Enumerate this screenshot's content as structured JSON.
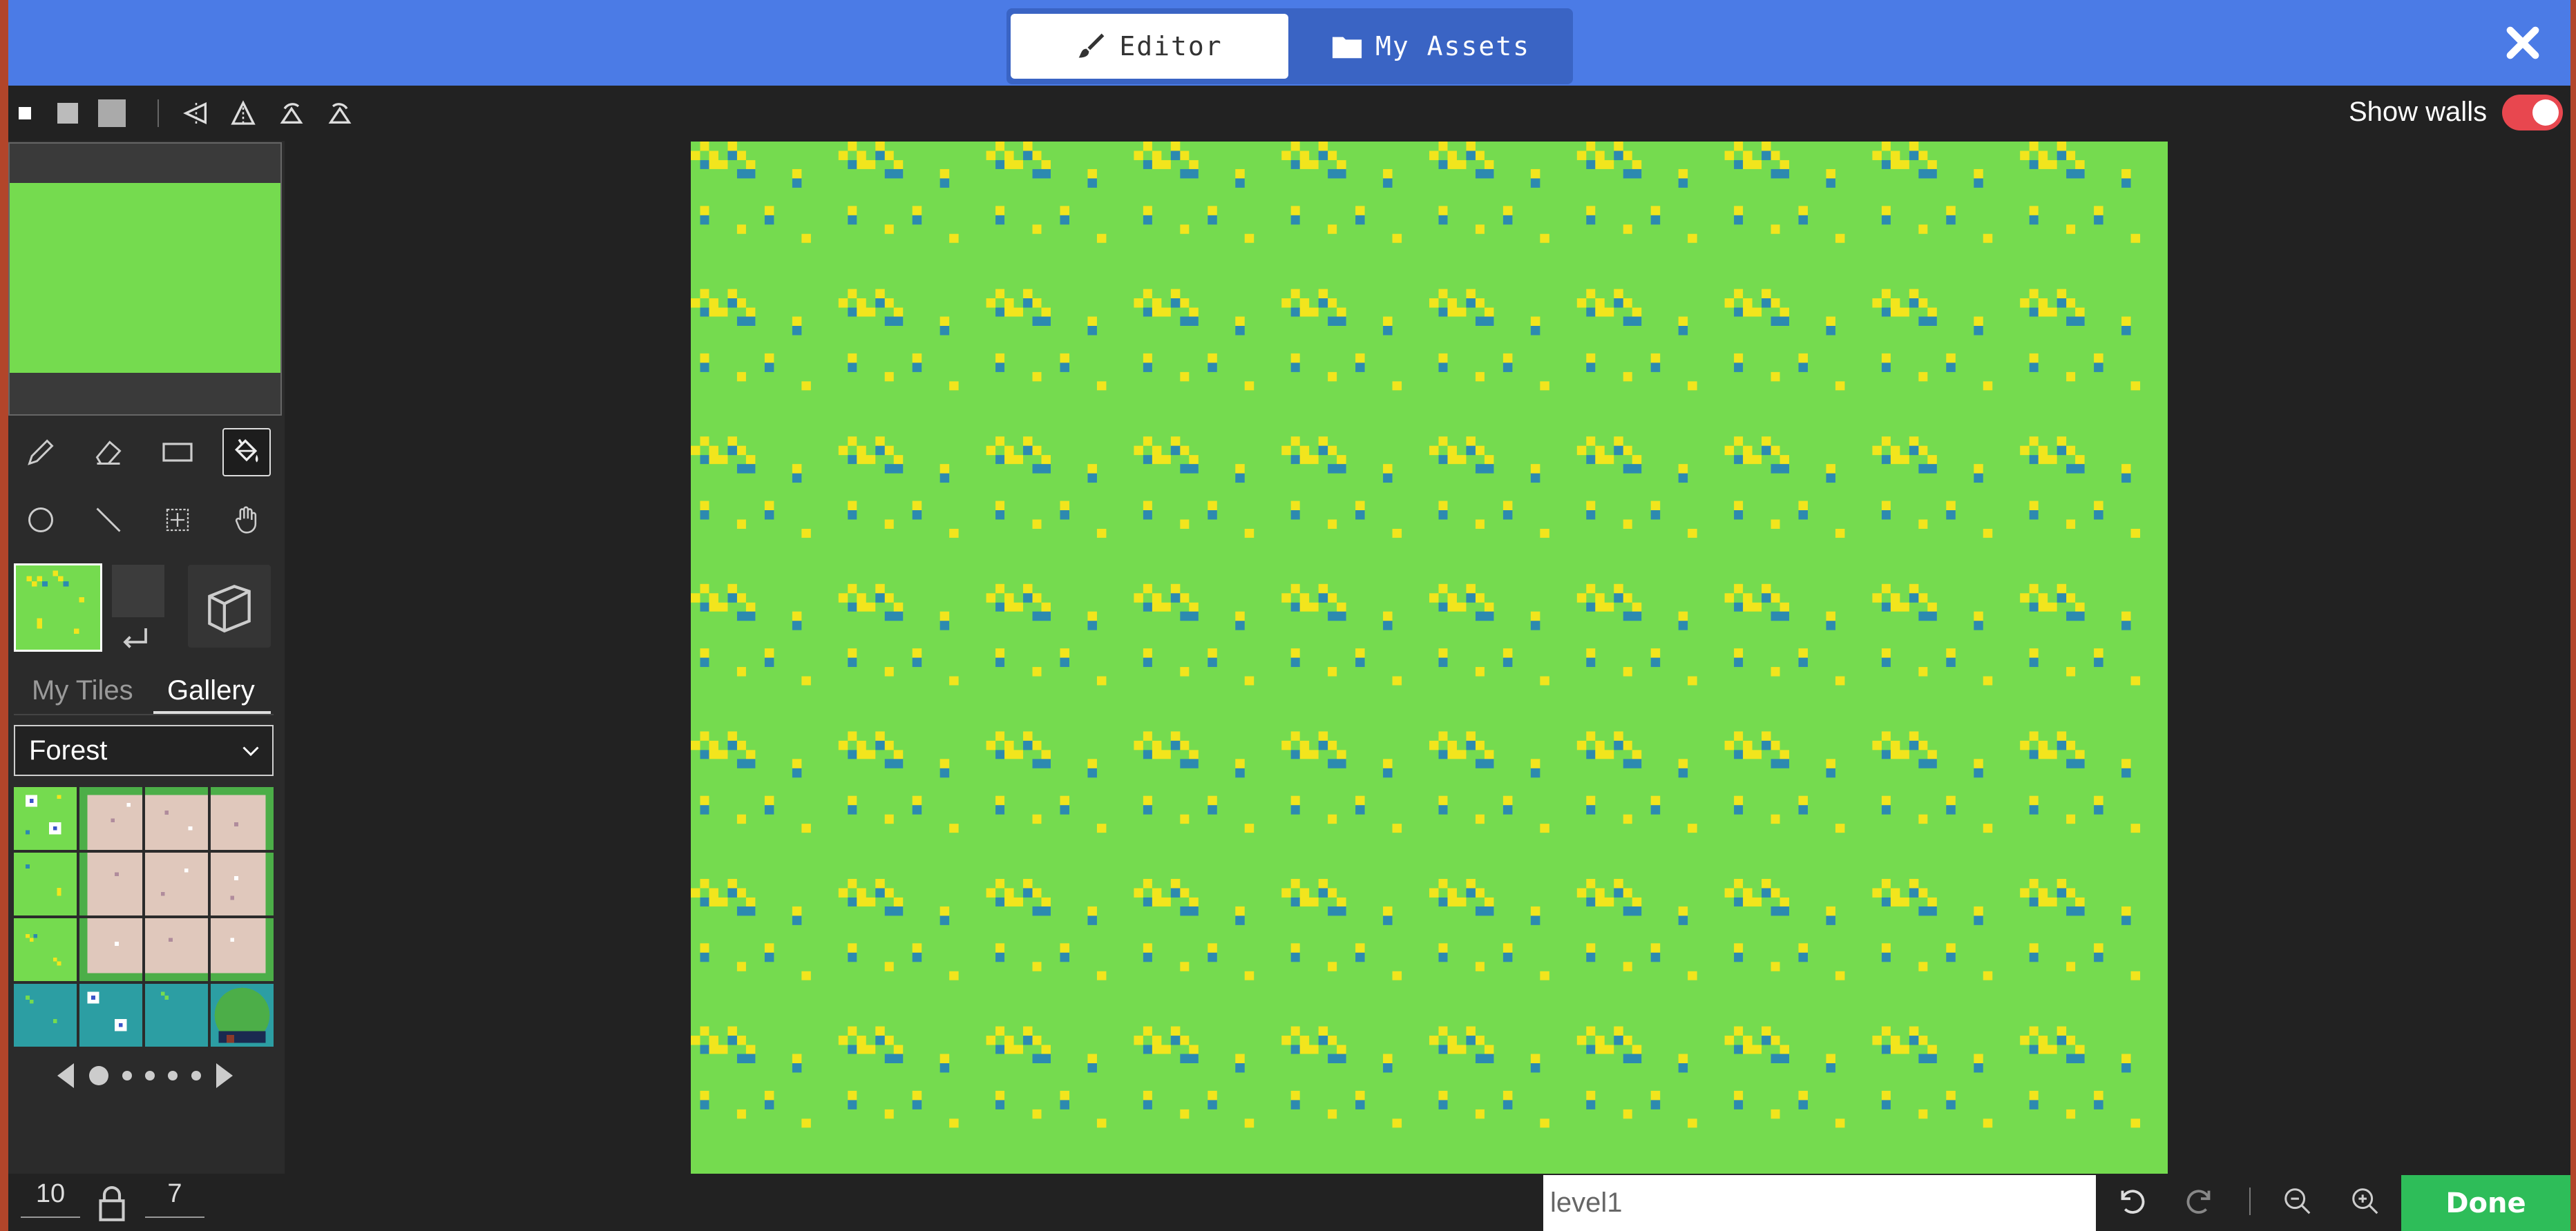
{
  "header": {
    "tabs": [
      {
        "label": "Editor",
        "icon": "paintbrush-icon",
        "active": true
      },
      {
        "label": "My Assets",
        "icon": "folder-icon",
        "active": false
      }
    ],
    "close_icon": "close-icon"
  },
  "toolbar": {
    "brush_sizes": [
      "small",
      "medium",
      "large"
    ],
    "symmetry_tools": [
      "flip-horizontal",
      "flip-vertical",
      "rotate-cw",
      "rotate-ccw"
    ],
    "show_walls_label": "Show walls",
    "show_walls_on": true
  },
  "tools": {
    "row1": [
      "pencil-icon",
      "eraser-icon",
      "rectangle-icon",
      "fill-bucket-icon"
    ],
    "row2": [
      "circle-icon",
      "line-icon",
      "marquee-icon",
      "pan-hand-icon"
    ],
    "active": "fill-bucket-icon"
  },
  "tile_panel": {
    "tabs": [
      "My Tiles",
      "Gallery"
    ],
    "active_tab": "Gallery",
    "category": "Forest",
    "pager": {
      "pages": 5,
      "current": 1
    }
  },
  "map": {
    "width": "10",
    "height": "7",
    "name": "level1"
  },
  "bottom": {
    "done_label": "Done"
  },
  "colors": {
    "accent_blue": "#4b7be6",
    "grass": "#75db4f",
    "flower_yellow": "#f2e51d",
    "flower_blue": "#2c8ab0",
    "done_green": "#2ebd59",
    "toggle_red": "#e8474f"
  }
}
